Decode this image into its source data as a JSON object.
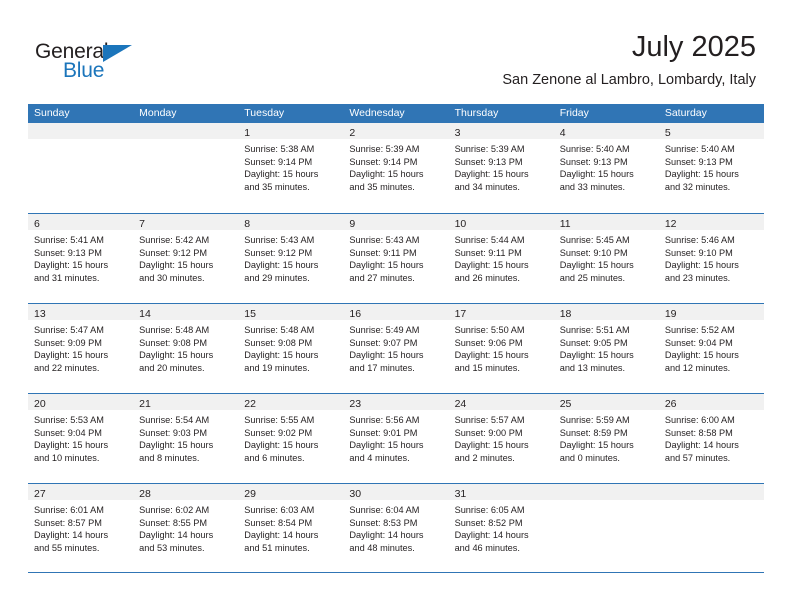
{
  "brand": {
    "name_part1": "General",
    "name_part2": "Blue",
    "triangle_icon": "triangle-icon",
    "color_dark": "#231f20",
    "color_blue": "#1b75bb"
  },
  "header": {
    "title": "July 2025",
    "subtitle": "San Zenone al Lambro, Lombardy, Italy"
  },
  "theme": {
    "header_blue": "#3075b5",
    "day_band_gray": "#f1f1f1",
    "text_color": "#231f20"
  },
  "weekdays": [
    "Sunday",
    "Monday",
    "Tuesday",
    "Wednesday",
    "Thursday",
    "Friday",
    "Saturday"
  ],
  "weeks": [
    [
      {
        "day": "",
        "sunrise": "",
        "sunset": "",
        "daylight": "",
        "empty": true
      },
      {
        "day": "",
        "sunrise": "",
        "sunset": "",
        "daylight": "",
        "empty": true
      },
      {
        "day": "1",
        "sunrise": "Sunrise: 5:38 AM",
        "sunset": "Sunset: 9:14 PM",
        "daylight": "Daylight: 15 hours and 35 minutes."
      },
      {
        "day": "2",
        "sunrise": "Sunrise: 5:39 AM",
        "sunset": "Sunset: 9:14 PM",
        "daylight": "Daylight: 15 hours and 35 minutes."
      },
      {
        "day": "3",
        "sunrise": "Sunrise: 5:39 AM",
        "sunset": "Sunset: 9:13 PM",
        "daylight": "Daylight: 15 hours and 34 minutes."
      },
      {
        "day": "4",
        "sunrise": "Sunrise: 5:40 AM",
        "sunset": "Sunset: 9:13 PM",
        "daylight": "Daylight: 15 hours and 33 minutes."
      },
      {
        "day": "5",
        "sunrise": "Sunrise: 5:40 AM",
        "sunset": "Sunset: 9:13 PM",
        "daylight": "Daylight: 15 hours and 32 minutes."
      }
    ],
    [
      {
        "day": "6",
        "sunrise": "Sunrise: 5:41 AM",
        "sunset": "Sunset: 9:13 PM",
        "daylight": "Daylight: 15 hours and 31 minutes."
      },
      {
        "day": "7",
        "sunrise": "Sunrise: 5:42 AM",
        "sunset": "Sunset: 9:12 PM",
        "daylight": "Daylight: 15 hours and 30 minutes."
      },
      {
        "day": "8",
        "sunrise": "Sunrise: 5:43 AM",
        "sunset": "Sunset: 9:12 PM",
        "daylight": "Daylight: 15 hours and 29 minutes."
      },
      {
        "day": "9",
        "sunrise": "Sunrise: 5:43 AM",
        "sunset": "Sunset: 9:11 PM",
        "daylight": "Daylight: 15 hours and 27 minutes."
      },
      {
        "day": "10",
        "sunrise": "Sunrise: 5:44 AM",
        "sunset": "Sunset: 9:11 PM",
        "daylight": "Daylight: 15 hours and 26 minutes."
      },
      {
        "day": "11",
        "sunrise": "Sunrise: 5:45 AM",
        "sunset": "Sunset: 9:10 PM",
        "daylight": "Daylight: 15 hours and 25 minutes."
      },
      {
        "day": "12",
        "sunrise": "Sunrise: 5:46 AM",
        "sunset": "Sunset: 9:10 PM",
        "daylight": "Daylight: 15 hours and 23 minutes."
      }
    ],
    [
      {
        "day": "13",
        "sunrise": "Sunrise: 5:47 AM",
        "sunset": "Sunset: 9:09 PM",
        "daylight": "Daylight: 15 hours and 22 minutes."
      },
      {
        "day": "14",
        "sunrise": "Sunrise: 5:48 AM",
        "sunset": "Sunset: 9:08 PM",
        "daylight": "Daylight: 15 hours and 20 minutes."
      },
      {
        "day": "15",
        "sunrise": "Sunrise: 5:48 AM",
        "sunset": "Sunset: 9:08 PM",
        "daylight": "Daylight: 15 hours and 19 minutes."
      },
      {
        "day": "16",
        "sunrise": "Sunrise: 5:49 AM",
        "sunset": "Sunset: 9:07 PM",
        "daylight": "Daylight: 15 hours and 17 minutes."
      },
      {
        "day": "17",
        "sunrise": "Sunrise: 5:50 AM",
        "sunset": "Sunset: 9:06 PM",
        "daylight": "Daylight: 15 hours and 15 minutes."
      },
      {
        "day": "18",
        "sunrise": "Sunrise: 5:51 AM",
        "sunset": "Sunset: 9:05 PM",
        "daylight": "Daylight: 15 hours and 13 minutes."
      },
      {
        "day": "19",
        "sunrise": "Sunrise: 5:52 AM",
        "sunset": "Sunset: 9:04 PM",
        "daylight": "Daylight: 15 hours and 12 minutes."
      }
    ],
    [
      {
        "day": "20",
        "sunrise": "Sunrise: 5:53 AM",
        "sunset": "Sunset: 9:04 PM",
        "daylight": "Daylight: 15 hours and 10 minutes."
      },
      {
        "day": "21",
        "sunrise": "Sunrise: 5:54 AM",
        "sunset": "Sunset: 9:03 PM",
        "daylight": "Daylight: 15 hours and 8 minutes."
      },
      {
        "day": "22",
        "sunrise": "Sunrise: 5:55 AM",
        "sunset": "Sunset: 9:02 PM",
        "daylight": "Daylight: 15 hours and 6 minutes."
      },
      {
        "day": "23",
        "sunrise": "Sunrise: 5:56 AM",
        "sunset": "Sunset: 9:01 PM",
        "daylight": "Daylight: 15 hours and 4 minutes."
      },
      {
        "day": "24",
        "sunrise": "Sunrise: 5:57 AM",
        "sunset": "Sunset: 9:00 PM",
        "daylight": "Daylight: 15 hours and 2 minutes."
      },
      {
        "day": "25",
        "sunrise": "Sunrise: 5:59 AM",
        "sunset": "Sunset: 8:59 PM",
        "daylight": "Daylight: 15 hours and 0 minutes."
      },
      {
        "day": "26",
        "sunrise": "Sunrise: 6:00 AM",
        "sunset": "Sunset: 8:58 PM",
        "daylight": "Daylight: 14 hours and 57 minutes."
      }
    ],
    [
      {
        "day": "27",
        "sunrise": "Sunrise: 6:01 AM",
        "sunset": "Sunset: 8:57 PM",
        "daylight": "Daylight: 14 hours and 55 minutes."
      },
      {
        "day": "28",
        "sunrise": "Sunrise: 6:02 AM",
        "sunset": "Sunset: 8:55 PM",
        "daylight": "Daylight: 14 hours and 53 minutes."
      },
      {
        "day": "29",
        "sunrise": "Sunrise: 6:03 AM",
        "sunset": "Sunset: 8:54 PM",
        "daylight": "Daylight: 14 hours and 51 minutes."
      },
      {
        "day": "30",
        "sunrise": "Sunrise: 6:04 AM",
        "sunset": "Sunset: 8:53 PM",
        "daylight": "Daylight: 14 hours and 48 minutes."
      },
      {
        "day": "31",
        "sunrise": "Sunrise: 6:05 AM",
        "sunset": "Sunset: 8:52 PM",
        "daylight": "Daylight: 14 hours and 46 minutes."
      },
      {
        "day": "",
        "sunrise": "",
        "sunset": "",
        "daylight": "",
        "empty": true
      },
      {
        "day": "",
        "sunrise": "",
        "sunset": "",
        "daylight": "",
        "empty": true
      }
    ]
  ]
}
